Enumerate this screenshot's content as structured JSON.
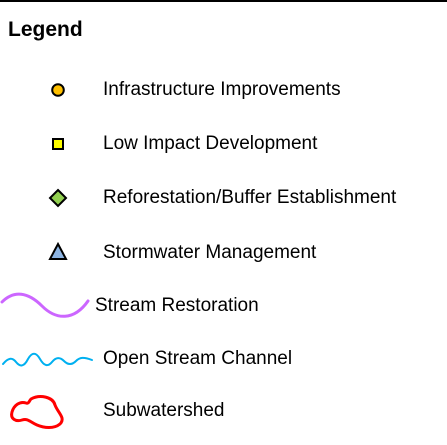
{
  "legend": {
    "title": "Legend",
    "items": [
      {
        "label": "Infrastructure Improvements",
        "symbol": "circle-icon",
        "fill": "#FFC000",
        "stroke": "#000000"
      },
      {
        "label": "Low Impact Development",
        "symbol": "square-icon",
        "fill": "#FFFF00",
        "stroke": "#000000"
      },
      {
        "label": "Reforestation/Buffer Establishment",
        "symbol": "diamond-icon",
        "fill": "#92D050",
        "stroke": "#000000"
      },
      {
        "label": "Stormwater Management",
        "symbol": "triangle-icon",
        "fill": "#8DB4E2",
        "stroke": "#000000"
      },
      {
        "label": "Stream Restoration",
        "symbol": "curve-line-icon",
        "stroke": "#CC66FF"
      },
      {
        "label": "Open Stream Channel",
        "symbol": "wavy-line-icon",
        "stroke": "#00B0F0"
      },
      {
        "label": "Subwatershed",
        "symbol": "polygon-outline-icon",
        "stroke": "#FF0000"
      }
    ]
  }
}
